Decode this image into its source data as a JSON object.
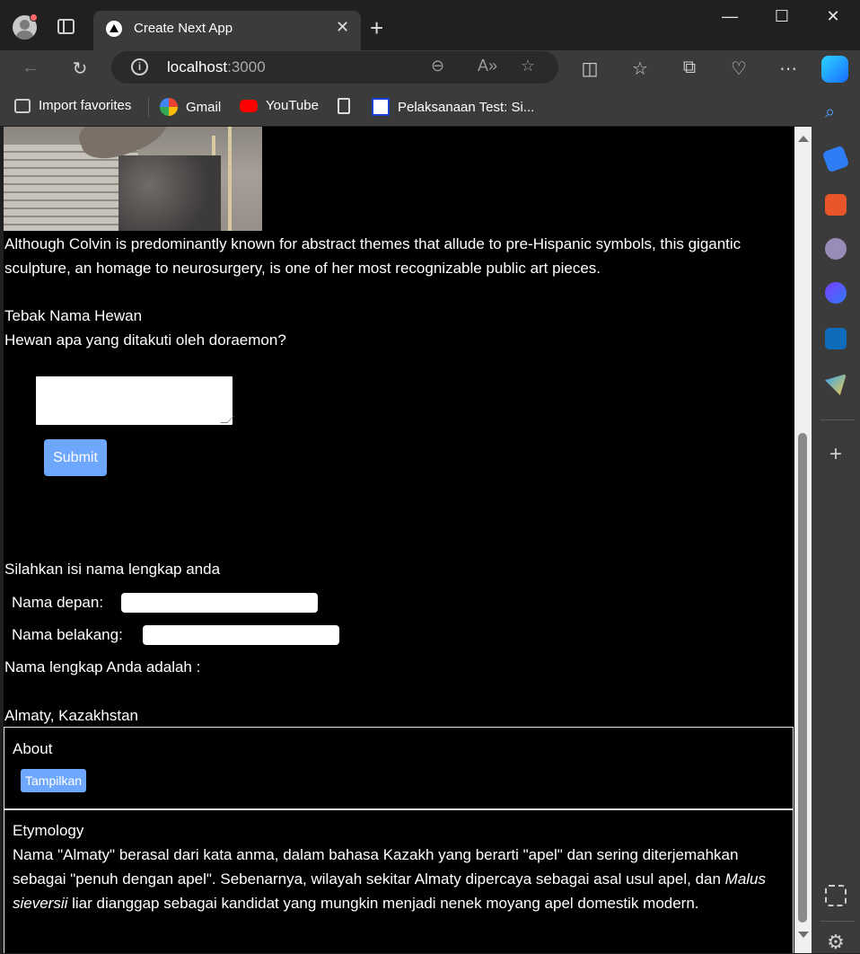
{
  "browser": {
    "tab_title": "Create Next App",
    "url_host": "localhost",
    "url_port": ":3000",
    "bookmarks": [
      "Import favorites",
      "Gmail",
      "YouTube",
      "Pelaksanaan Test: Si..."
    ]
  },
  "page": {
    "image_caption": "Although Colvin is predominantly known for abstract themes that allude to pre-Hispanic symbols, this gigantic sculpture, an homage to neurosurgery, is one of her most recognizable public art pieces.",
    "quiz_title": "Tebak Nama Hewan",
    "quiz_question": "Hewan apa yang ditakuti oleh doraemon?",
    "submit_label": "Submit",
    "form_title": "Silahkan isi nama lengkap anda",
    "first_name_label": "Nama depan:",
    "last_name_label": "Nama belakang:",
    "full_name_label": "Nama lengkap Anda adalah :",
    "city": "Almaty, Kazakhstan",
    "about_title": "About",
    "show_button": "Tampilkan",
    "etymology_title": "Etymology",
    "etymology_text_before": "Nama \"Almaty\" berasal dari kata anma, dalam bahasa Kazakh yang berarti \"apel\" dan sering diterjemahkan sebagai \"penuh dengan apel\". Sebenarnya, wilayah sekitar Almaty dipercaya sebagai asal usul apel, dan ",
    "etymology_italic": "Malus sieversii",
    "etymology_text_after": " liar dianggap sebagai kandidat yang mungkin menjadi nenek moyang apel domestik modern."
  }
}
